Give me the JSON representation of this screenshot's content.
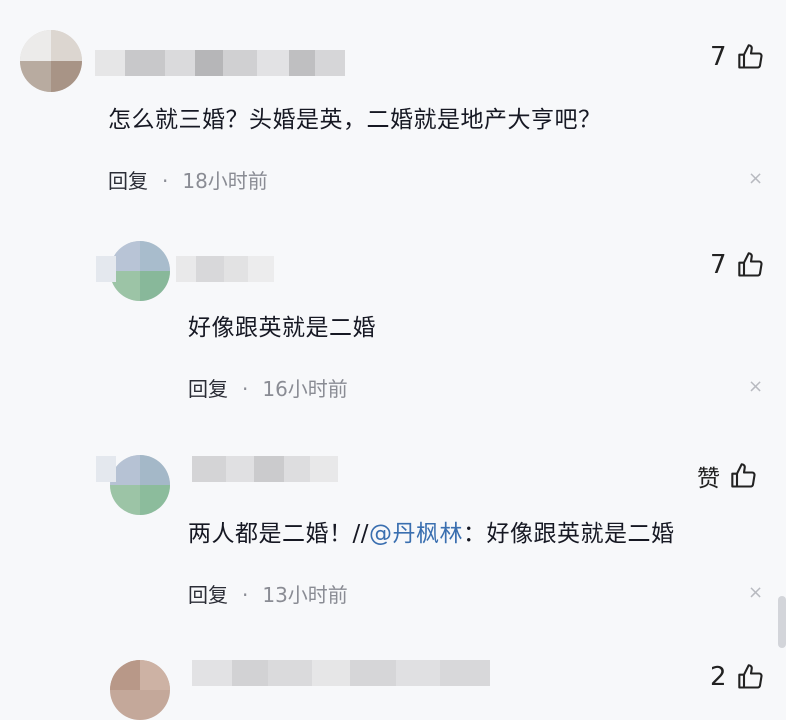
{
  "comments": [
    {
      "text": "怎么就三婚？头婚是英，二婚就是地产大亨吧？",
      "reply": "回复",
      "sep": "·",
      "time": "18小时前",
      "likes": "7",
      "close": "×"
    },
    {
      "text": "好像跟英就是二婚",
      "reply": "回复",
      "sep": "·",
      "time": "16小时前",
      "likes": "7",
      "close": "×"
    },
    {
      "text_before": "两人都是二婚！//",
      "mention": "@丹枫林",
      "text_after": "：好像跟英就是二婚",
      "reply": "回复",
      "sep": "·",
      "time": "13小时前",
      "likes": "赞",
      "close": "×"
    },
    {
      "likes": "2"
    }
  ],
  "colors": {
    "accent_link": "#3a6fb0",
    "background": "#f7f8fa"
  },
  "icons": {
    "like": "thumbs-up-icon",
    "close": "close-icon",
    "avatar": "blurred-avatar"
  }
}
